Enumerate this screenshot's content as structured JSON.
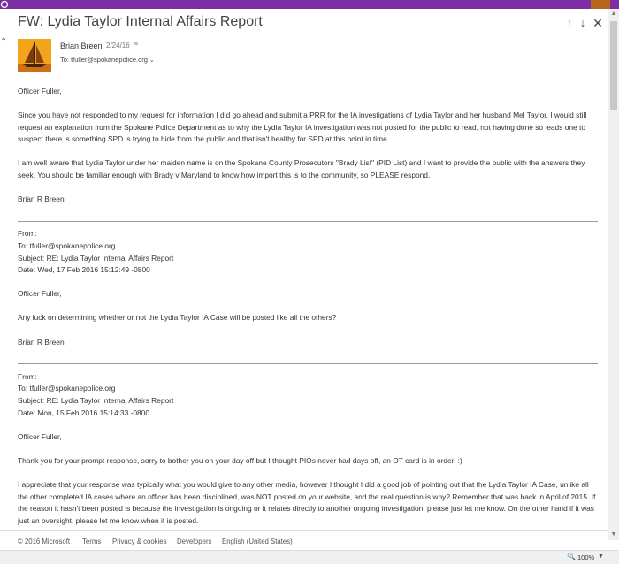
{
  "email": {
    "subject": "FW: Lydia Taylor Internal Affairs Report",
    "sender": "Brian Breen",
    "date": "2/24/16",
    "to": "To: tfuller@spokanepolice.org"
  },
  "message": {
    "greeting": "Officer Fuller,",
    "para1": "Since you have not responded to my request for information I did go ahead and submit a PRR for the IA investigations of Lydia Taylor and her husband Mel Taylor. I would still request an explanation from the Spokane Police Department as to why the Lydia Taylor IA investigation was not posted for the public to read, not having done so leads one to suspect there is something SPD is trying to hide from the public and that isn't healthy for SPD at this point in time.",
    "para2": "I am well aware that Lydia Taylor under her maiden name is on the Spokane County Prosecutors \"Brady List\" (PID List) and I want to provide the public with the answers they seek. You should be familiar enough with Brady v Maryland to know how import this is to the community, so PLEASE respond.",
    "signature": "Brian R Breen"
  },
  "forward1": {
    "from": "From:",
    "to": "To: tfuller@spokanepolice.org",
    "subject": "Subject: RE: Lydia Taylor Internal Affairs Report",
    "date": "Date: Wed, 17 Feb 2016 15:12:49 -0800",
    "greeting": "Officer Fuller,",
    "body": "Any luck on determining whether or not the Lydia Taylor IA Case will be posted like all the others?",
    "signature": "Brian R Breen"
  },
  "forward2": {
    "from": "From:",
    "to": "To: tfuller@spokanepolice.org",
    "subject": "Subject: RE: Lydia Taylor Internal Affairs Report",
    "date": "Date: Mon, 15 Feb 2016 15:14:33 -0800",
    "greeting": "Officer Fuller,",
    "para1": "Thank you for your prompt response, sorry to bother you on your day off but I thought PIOs never had days off, an OT card is in order. :)",
    "para2": "I appreciate that your response was typically what you would give to any other media, however I thought I did a good job of pointing out that the Lydia Taylor IA Case, unlike all the other completed IA cases where an officer has been disciplined, was NOT posted on your website, and the real question is why? Remember that was back in April of 2015. If the reason it hasn't been posted is because the investigation is ongoing or it relates directly to another ongoing investigation, please just let me know. On the other hand if it was just an oversight, please let me know when it is posted."
  },
  "footer": {
    "copyright": "© 2016 Microsoft",
    "terms": "Terms",
    "privacy": "Privacy & cookies",
    "developers": "Developers",
    "language": "English (United States)"
  },
  "status": {
    "zoom": "100%"
  },
  "icons": {
    "accent": "#7b2fa2",
    "avatar_bg": "#f2a51a"
  }
}
